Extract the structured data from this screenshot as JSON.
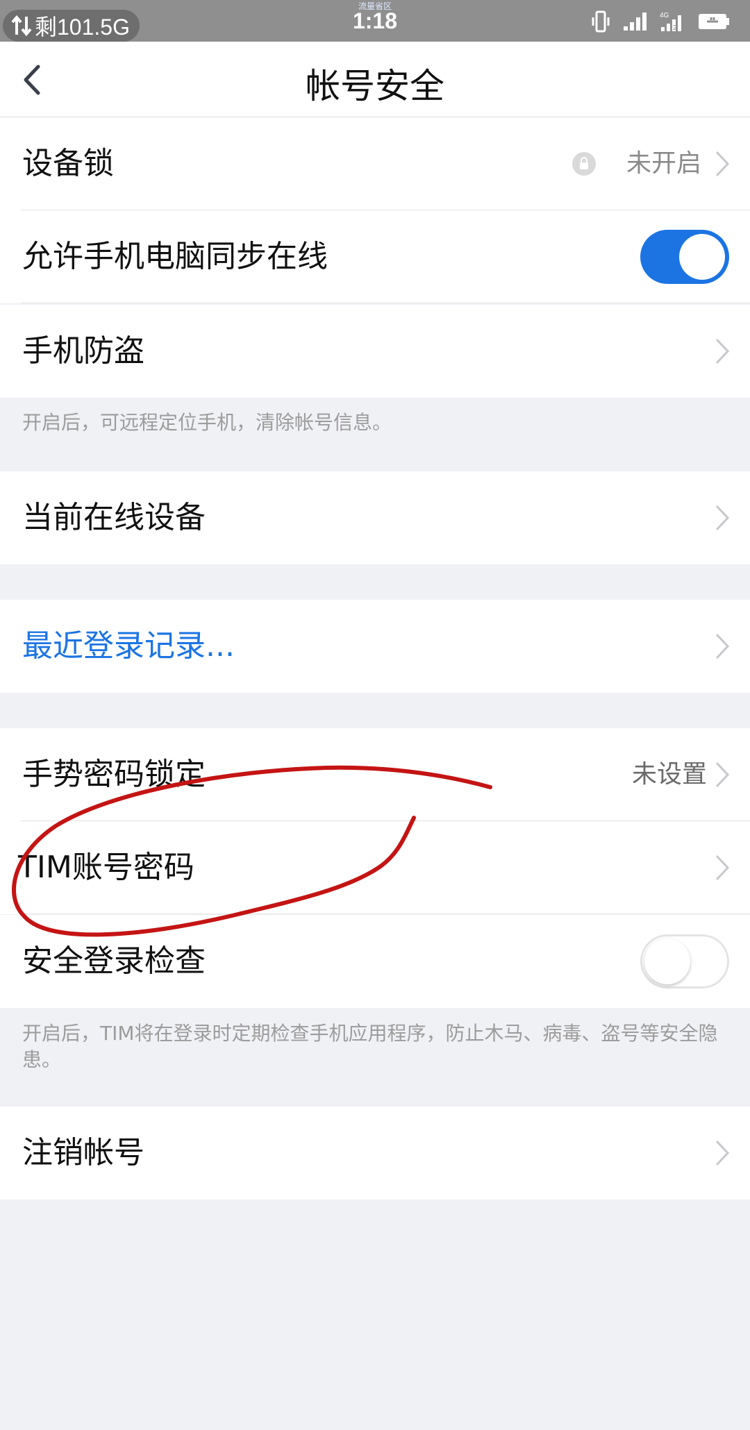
{
  "status_bar": {
    "traffic_text": "剩101.5G",
    "sublabel": "流量省区",
    "time": "1:18",
    "icons": [
      "vibrate-icon",
      "signal-icon",
      "4g-signal-icon",
      "battery-charging-icon"
    ],
    "network_label": "4G",
    "sim_label": "2"
  },
  "header": {
    "title": "帐号安全"
  },
  "rows": {
    "device_lock": {
      "label": "设备锁",
      "value": "未开启"
    },
    "sync_online": {
      "label": "允许手机电脑同步在线",
      "toggle": "on"
    },
    "anti_theft": {
      "label": "手机防盗"
    },
    "anti_theft_hint": "开启后，可远程定位手机，清除帐号信息。",
    "online_devices": {
      "label": "当前在线设备"
    },
    "recent_login": {
      "label": "最近登录记录..."
    },
    "gesture_lock": {
      "label": "手势密码锁定",
      "value": "未设置"
    },
    "tim_password": {
      "label": "TIM账号密码"
    },
    "security_check": {
      "label": "安全登录检查",
      "toggle": "off"
    },
    "security_check_hint": "开启后，TIM将在登录时定期检查手机应用程序，防止木马、病毒、盗号等安全隐患。",
    "deactivate": {
      "label": "注销帐号"
    }
  },
  "colors": {
    "accent": "#1c74e3",
    "annotation": "#c41414",
    "background": "#f0f1f5"
  }
}
